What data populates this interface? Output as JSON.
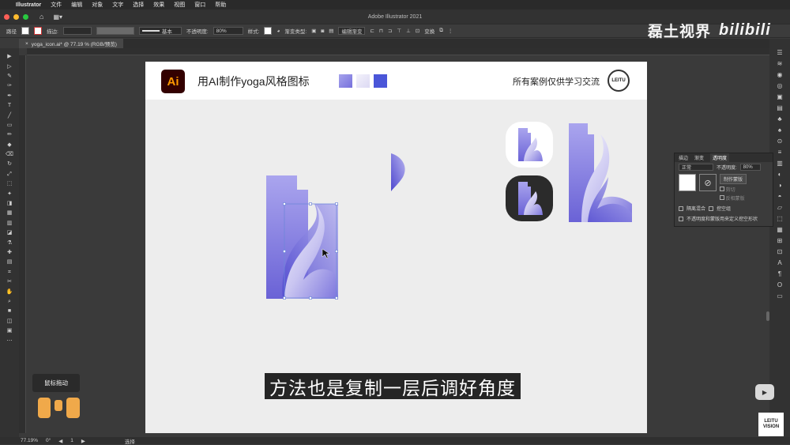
{
  "menubar": {
    "apple_glyph": "",
    "app_name": "Illustrator",
    "items": [
      "文件",
      "编辑",
      "对象",
      "文字",
      "选择",
      "效果",
      "视图",
      "窗口",
      "帮助"
    ]
  },
  "titlebar": {
    "title": "Adobe Illustrator 2021"
  },
  "controlbar": {
    "path_label": "路径",
    "stroke_label": "描边:",
    "stroke_value": "基本",
    "opacity_label": "不透明度:",
    "opacity_value": "80%",
    "style_label": "样式:",
    "gradient_type_label": "渐变类型:",
    "edit_gradient_button": "编辑渐变",
    "transform_label": "变换"
  },
  "document_tab": {
    "close_glyph": "×",
    "title": "yoga_icon.ai* @ 77.19 % (RGB/预览)"
  },
  "tools": [
    "▶",
    "▷",
    "✎",
    "✑",
    "✒",
    "T",
    "╱",
    "▭",
    "✏",
    "◆",
    "⌫",
    "↻",
    "⤢",
    "⬚",
    "✦",
    "◨",
    "▦",
    "▥",
    "◪",
    "⚗",
    "✚",
    "▤",
    "⌗",
    "✂",
    "✋",
    "⌕",
    "■",
    "◫",
    "▣",
    "⋯"
  ],
  "right_tools": [
    "☰",
    "≋",
    "◉",
    "◎",
    "▣",
    "▤",
    "♣",
    "♠",
    "⊙",
    "≡",
    "▥",
    "◐",
    "◑",
    "◓",
    "▱",
    "⬚",
    "▦",
    "⊞",
    "⊡",
    "A",
    "¶",
    "O",
    "▭"
  ],
  "artboard": {
    "logo_text": "Ai",
    "title": "用AI制作yoga风格图标",
    "note": "所有案例仅供学习交流",
    "badge_text": "LEITU",
    "swatch_colors": [
      "#8b87e0",
      "#e8e6f7",
      "#4a56d8"
    ],
    "icon_gradient_light": "#d9d6f5",
    "icon_gradient_dark": "#6f68d8",
    "dark_icon_bg": "#2b2b2b"
  },
  "transparency_panel": {
    "tabs": [
      "描边",
      "渐变",
      "透明度"
    ],
    "blend_mode": "正常",
    "opacity_label": "不透明度:",
    "opacity_value": "80%",
    "make_mask_button": "制作蒙版",
    "clip_label": "剪切",
    "invert_mask_label": "反相蒙版",
    "isolate_blending_label": "隔离混合",
    "knockout_group_label": "挖空组",
    "opacity_mask_define_label": "不透明度和蒙版用来定义挖空形状"
  },
  "tooltip": {
    "text": "鼠标拖动"
  },
  "subtitle": {
    "text": "方法也是复制一层后调好角度"
  },
  "watermark": {
    "text": "磊土视界",
    "bili": "bilibili"
  },
  "leitu_logo": {
    "line1": "LEITU",
    "line2": "VISION"
  },
  "statusbar": {
    "zoom": "77.19%",
    "rotation": "0°",
    "artboard_index": "1",
    "tool_name": "选择"
  },
  "colors": {
    "accent": "#ff9a00",
    "panel_bg": "#323232",
    "tl_red": "#ff5f57",
    "tl_yellow": "#febc2e",
    "tl_green": "#28c840",
    "mouse_icon": "#f0a94a"
  }
}
